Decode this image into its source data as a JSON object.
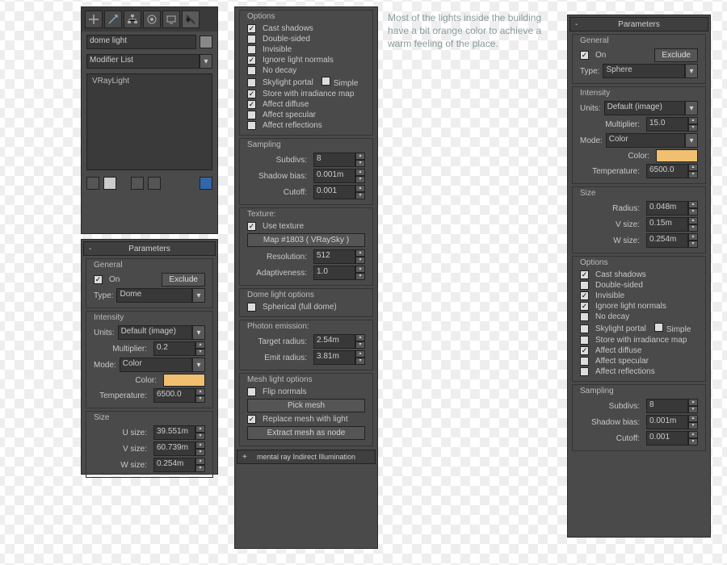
{
  "note": "Most of the lights inside the building have a bit orange color to achieve a warm feeling of the place.",
  "modify": {
    "name": "dome light",
    "modlist": "Modifier List",
    "stack": [
      "VRayLight"
    ]
  },
  "paramsTitle": "Parameters",
  "left": {
    "general": {
      "title": "General",
      "on": true,
      "onLabel": "On",
      "exclude": "Exclude",
      "typeLabel": "Type:",
      "type": "Dome"
    },
    "intensity": {
      "title": "Intensity",
      "unitsLabel": "Units:",
      "units": "Default (image)",
      "multLabel": "Multiplier:",
      "mult": "0.2",
      "modeLabel": "Mode:",
      "mode": "Color",
      "colorLabel": "Color:",
      "color": "#f0c070",
      "tempLabel": "Temperature:",
      "temp": "6500.0"
    },
    "size": {
      "title": "Size",
      "uLabel": "U size:",
      "u": "39.551m",
      "vLabel": "V size:",
      "v": "60.739m",
      "wLabel": "W size:",
      "w": "0.254m"
    }
  },
  "mid": {
    "options": {
      "title": "Options",
      "items": [
        {
          "l": "Cast shadows",
          "c": true
        },
        {
          "l": "Double-sided",
          "c": false
        },
        {
          "l": "Invisible",
          "c": false
        },
        {
          "l": "Ignore light normals",
          "c": true
        },
        {
          "l": "No decay",
          "c": false
        },
        {
          "l": "Skylight portal",
          "c": false,
          "simple": "Simple"
        },
        {
          "l": "Store with irradiance map",
          "c": true
        },
        {
          "l": "Affect diffuse",
          "c": true
        },
        {
          "l": "Affect specular",
          "c": false
        },
        {
          "l": "Affect reflections",
          "c": false
        }
      ]
    },
    "sampling": {
      "title": "Sampling",
      "subLabel": "Subdivs:",
      "sub": "8",
      "biasLabel": "Shadow bias:",
      "bias": "0.001m",
      "cutLabel": "Cutoff:",
      "cut": "0.001"
    },
    "texture": {
      "title": "Texture:",
      "useLabel": "Use texture",
      "use": true,
      "map": "Map #1803  ( VRaySky )",
      "resLabel": "Resolution:",
      "res": "512",
      "adaptLabel": "Adaptiveness:",
      "adapt": "1.0"
    },
    "dome": {
      "title": "Dome light options",
      "sphLabel": "Spherical (full dome)",
      "sph": false
    },
    "photon": {
      "title": "Photon emission:",
      "tgtLabel": "Target radius:",
      "tgt": "2.54m",
      "emitLabel": "Emit radius:",
      "emit": "3.81m"
    },
    "mesh": {
      "title": "Mesh light options",
      "flipLabel": "Flip normals",
      "flip": false,
      "pick": "Pick mesh",
      "repLabel": "Replace mesh with light",
      "rep": true,
      "extract": "Extract mesh as node"
    },
    "footer": "mental ray Indirect Illumination"
  },
  "right": {
    "general": {
      "title": "General",
      "on": true,
      "onLabel": "On",
      "exclude": "Exclude",
      "typeLabel": "Type:",
      "type": "Sphere"
    },
    "intensity": {
      "title": "Intensity",
      "unitsLabel": "Units:",
      "units": "Default (image)",
      "multLabel": "Multiplier:",
      "mult": "15.0",
      "modeLabel": "Mode:",
      "mode": "Color",
      "colorLabel": "Color:",
      "color": "#f0c070",
      "tempLabel": "Temperature:",
      "temp": "6500.0"
    },
    "size": {
      "title": "Size",
      "rLabel": "Radius:",
      "r": "0.048m",
      "vLabel": "V size:",
      "v": "0.15m",
      "wLabel": "W size:",
      "w": "0.254m"
    },
    "options": {
      "title": "Options",
      "items": [
        {
          "l": "Cast shadows",
          "c": true
        },
        {
          "l": "Double-sided",
          "c": false
        },
        {
          "l": "Invisible",
          "c": true
        },
        {
          "l": "Ignore light normals",
          "c": true
        },
        {
          "l": "No decay",
          "c": false
        },
        {
          "l": "Skylight portal",
          "c": false,
          "simple": "Simple"
        },
        {
          "l": "Store with irradiance map",
          "c": false
        },
        {
          "l": "Affect diffuse",
          "c": true
        },
        {
          "l": "Affect specular",
          "c": false
        },
        {
          "l": "Affect reflections",
          "c": false
        }
      ]
    },
    "sampling": {
      "title": "Sampling",
      "subLabel": "Subdivs:",
      "sub": "8",
      "biasLabel": "Shadow bias:",
      "bias": "0.001m",
      "cutLabel": "Cutoff:",
      "cut": "0.001"
    }
  }
}
